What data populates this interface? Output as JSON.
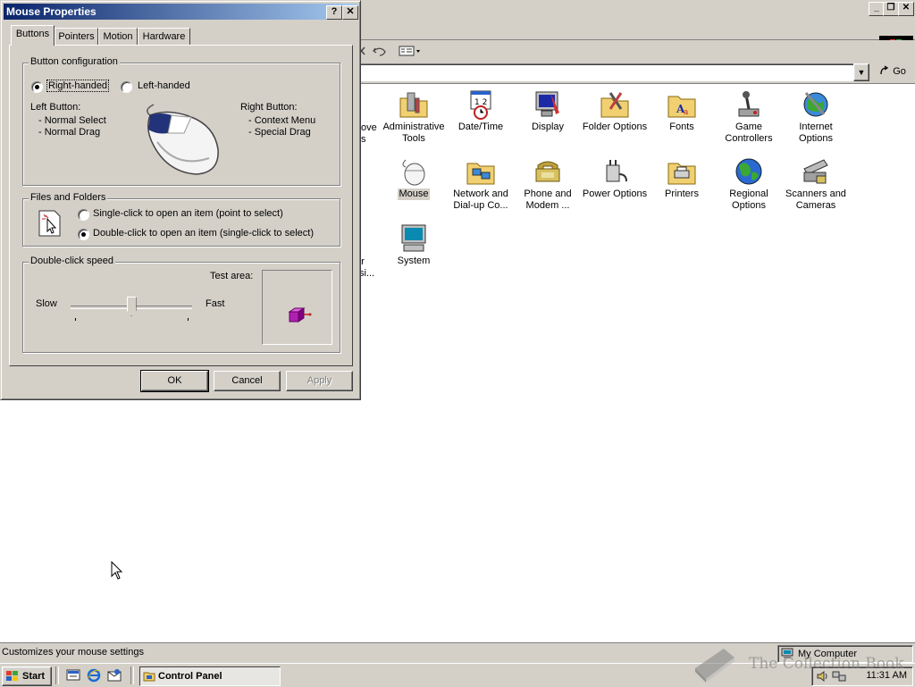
{
  "control_panel": {
    "window_title": "Control Panel",
    "address_go": "Go",
    "partial_labels": [
      "ove",
      "s",
      "er",
      "si..."
    ],
    "icons": [
      {
        "label": "Administrative Tools",
        "icon": "admin-tools-icon"
      },
      {
        "label": "Date/Time",
        "icon": "calendar-clock-icon"
      },
      {
        "label": "Display",
        "icon": "monitor-icon"
      },
      {
        "label": "Folder Options",
        "icon": "folder-options-icon"
      },
      {
        "label": "Fonts",
        "icon": "fonts-folder-icon"
      },
      {
        "label": "Game Controllers",
        "icon": "joystick-icon"
      },
      {
        "label": "Internet Options",
        "icon": "globe-tools-icon"
      },
      {
        "label": "Mouse",
        "icon": "mouse-icon"
      },
      {
        "label": "Network and Dial-up Co...",
        "icon": "network-icon"
      },
      {
        "label": "Phone and Modem ...",
        "icon": "phone-icon"
      },
      {
        "label": "Power Options",
        "icon": "plug-icon"
      },
      {
        "label": "Printers",
        "icon": "printer-folder-icon"
      },
      {
        "label": "Regional Options",
        "icon": "world-icon"
      },
      {
        "label": "Scanners and Cameras",
        "icon": "scanner-icon"
      },
      {
        "label": "System",
        "icon": "computer-icon"
      }
    ],
    "status_text": "Customizes your mouse settings",
    "status_zone": "My Computer"
  },
  "dialog": {
    "title": "Mouse Properties",
    "help_button": "?",
    "close_button": "✕",
    "tabs": [
      "Buttons",
      "Pointers",
      "Motion",
      "Hardware"
    ],
    "active_tab": "Buttons",
    "button_config": {
      "title": "Button configuration",
      "right_handed": "Right-handed",
      "left_handed": "Left-handed",
      "selected": "Right-handed",
      "left_button_label": "Left Button:",
      "left_button_items": [
        "-  Normal Select",
        "-  Normal Drag"
      ],
      "right_button_label": "Right Button:",
      "right_button_items": [
        "-  Context Menu",
        "-  Special Drag"
      ]
    },
    "files_folders": {
      "title": "Files and Folders",
      "single_click": "Single-click to open an item (point to select)",
      "double_click": "Double-click to open an item (single-click to select)",
      "selected": "double"
    },
    "double_click_speed": {
      "title": "Double-click speed",
      "slow": "Slow",
      "fast": "Fast",
      "test_area": "Test area:",
      "slider_value": 0.5
    },
    "buttons": {
      "ok": "OK",
      "cancel": "Cancel",
      "apply": "Apply"
    }
  },
  "taskbar": {
    "start": "Start",
    "task": "Control Panel",
    "clock": "11:31 AM"
  },
  "watermark": "The Collection Book"
}
